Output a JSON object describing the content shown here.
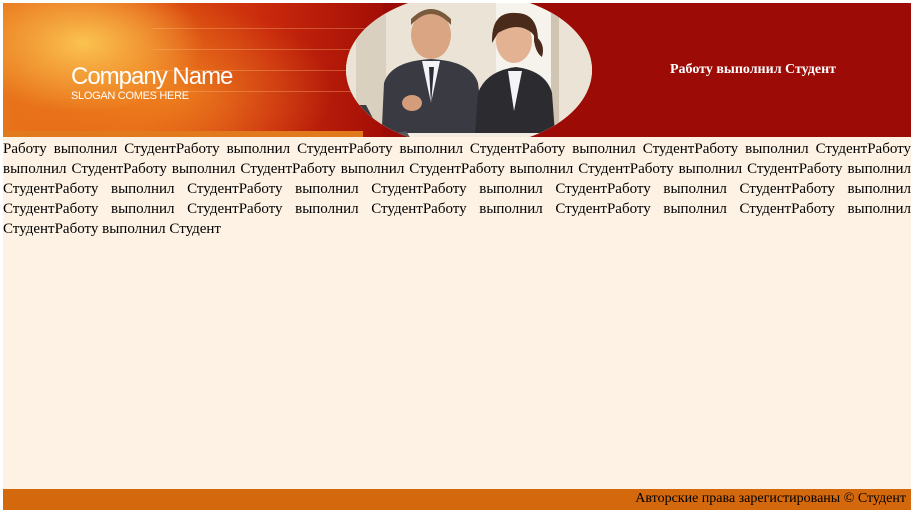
{
  "header": {
    "logo_name": "Company Name",
    "logo_slogan": "SLOGAN COMES HERE",
    "title": "Работу выполнил Студент"
  },
  "content": {
    "text": "Работу выполнил СтудентРаботу выполнил СтудентРаботу выполнил СтудентРаботу выполнил СтудентРаботу выполнил СтудентРаботу выполнил СтудентРаботу выполнил СтудентРаботу выполнил СтудентРаботу выполнил СтудентРаботу выполнил СтудентРаботу выполнил СтудентРаботу выполнил СтудентРаботу выполнил СтудентРаботу выполнил СтудентРаботу выполнил СтудентРаботу выполнил СтудентРаботу выполнил СтудентРаботу выполнил СтудентРаботу выполнил СтудентРаботу выполнил СтудентРаботу выполнил СтудентРаботу выполнил Студент"
  },
  "footer": {
    "copyright": "Авторские права зарегистированы © Студент"
  },
  "colors": {
    "banner_dark_red": "#9c0b05",
    "banner_orange": "#e8741a",
    "page_background": "#fdf2e4",
    "footer_bar": "#d4680d"
  }
}
